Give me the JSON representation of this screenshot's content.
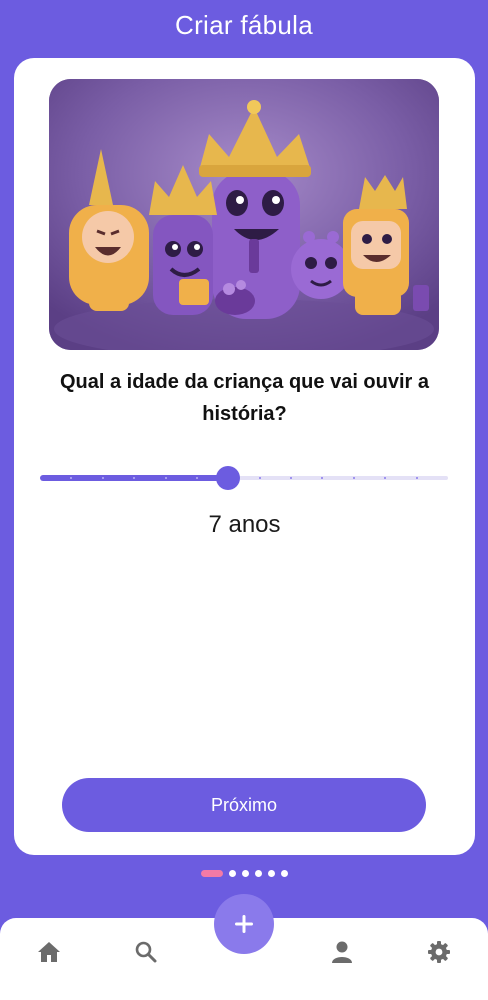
{
  "header": {
    "title": "Criar fábula"
  },
  "question": {
    "text": "Qual a idade da criança que vai ouvir a história?"
  },
  "age_slider": {
    "value": 7,
    "min": 1,
    "max": 14,
    "value_label": "7 anos"
  },
  "next_button": {
    "label": "Próximo"
  },
  "pager": {
    "total": 6,
    "active_index": 0
  },
  "bottom_nav": {
    "items": [
      {
        "icon": "home-icon"
      },
      {
        "icon": "search-icon"
      },
      {
        "icon": "plus-icon"
      },
      {
        "icon": "user-icon"
      },
      {
        "icon": "settings-icon"
      }
    ]
  },
  "colors": {
    "primary": "#6C5CE0",
    "fab": "#8A7AEB",
    "pager_active": "#F37AA6",
    "track_inactive": "#E4E1F6"
  }
}
